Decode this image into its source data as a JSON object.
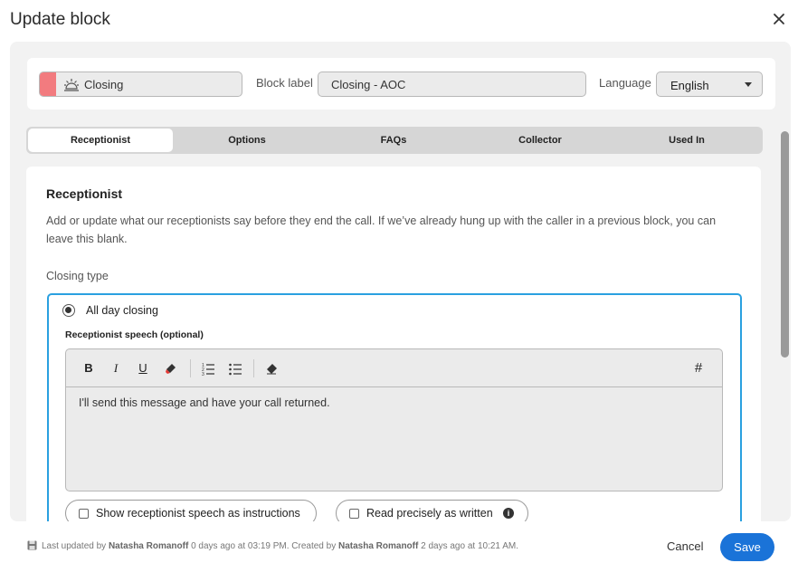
{
  "header": {
    "title": "Update block",
    "close_icon": "close-icon"
  },
  "block_type": {
    "label": "Closing",
    "color": "#f27b7f",
    "icon": "sunset-icon"
  },
  "block_label": {
    "label": "Block label",
    "value": "Closing - AOC"
  },
  "language": {
    "label": "Language",
    "value": "English"
  },
  "tabs": [
    {
      "label": "Receptionist",
      "active": true
    },
    {
      "label": "Options",
      "active": false
    },
    {
      "label": "FAQs",
      "active": false
    },
    {
      "label": "Collector",
      "active": false
    },
    {
      "label": "Used In",
      "active": false
    }
  ],
  "receptionist": {
    "title": "Receptionist",
    "description": "Add or update what our receptionists say before they end the call. If we’ve already hung up with the caller in a previous block, you can leave this blank.",
    "closing_type_label": "Closing type",
    "option": {
      "label": "All day closing",
      "selected": true,
      "speech_label": "Receptionist speech (optional)",
      "speech_text": "I'll send this message and have your call returned.",
      "toolbar": {
        "bold": "B",
        "italic": "I",
        "underline": "U",
        "hash": "#"
      },
      "show_as_instructions": {
        "label": "Show receptionist speech as instructions",
        "checked": false
      },
      "read_precisely": {
        "label": "Read precisely as written",
        "checked": false
      }
    }
  },
  "footer": {
    "updated_prefix": "Last updated by",
    "updated_by": "Natasha Romanoff",
    "updated_when": "0 days ago at 03:19 PM. Created by",
    "created_by": "Natasha Romanoff",
    "created_when": "2 days ago at 10:21 AM.",
    "cancel_label": "Cancel",
    "save_label": "Save",
    "accent_color": "#1a73d8"
  }
}
